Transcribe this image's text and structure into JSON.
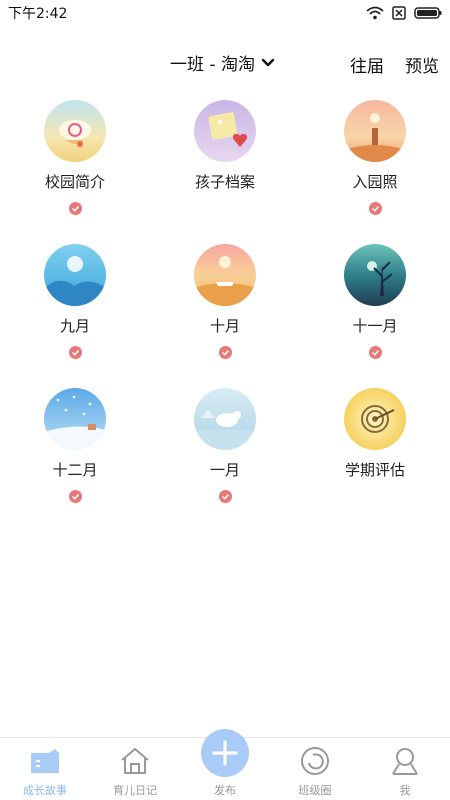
{
  "status": {
    "time": "下午2:42"
  },
  "header": {
    "class_name": "一班 - 淘淘",
    "past_label": "往届",
    "preview_label": "预览"
  },
  "grid": {
    "items": [
      {
        "label": "校园简介",
        "icon": "campus-intro-icon"
      },
      {
        "label": "孩子档案",
        "icon": "child-profile-icon"
      },
      {
        "label": "入园照",
        "icon": "enrollment-photo-icon"
      },
      {
        "label": "九月",
        "icon": "september-icon"
      },
      {
        "label": "十月",
        "icon": "october-icon"
      },
      {
        "label": "十一月",
        "icon": "november-icon"
      },
      {
        "label": "十二月",
        "icon": "december-icon"
      },
      {
        "label": "一月",
        "icon": "january-icon"
      },
      {
        "label": "学期评估",
        "icon": "semester-evaluation-icon"
      }
    ]
  },
  "tabbar": {
    "tabs": [
      {
        "label": "成长故事",
        "active": true
      },
      {
        "label": "育儿日记",
        "active": false
      },
      {
        "label": "发布",
        "active": false
      },
      {
        "label": "班级圈",
        "active": false
      },
      {
        "label": "我",
        "active": false
      }
    ]
  },
  "colors": {
    "accent": "#a8cbf7",
    "check": "#e87777",
    "active_tab": "#8cb9f0"
  }
}
